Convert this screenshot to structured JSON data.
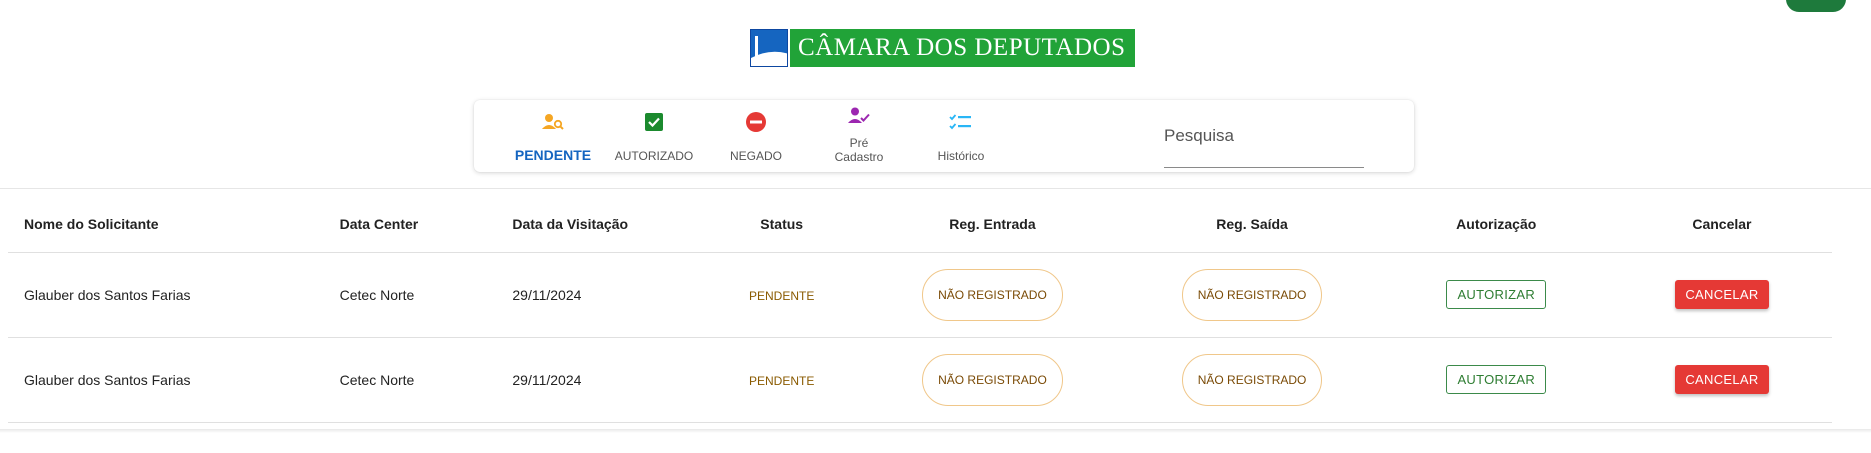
{
  "brand": {
    "name": "CÂMARA DOS DEPUTADOS",
    "green": "#21a338",
    "blue": "#1565c0"
  },
  "tabs": [
    {
      "label": "PENDENTE",
      "icon": "person-search-icon",
      "color": "#f5a623",
      "active": true
    },
    {
      "label": "AUTORIZADO",
      "icon": "checkbox-checked-icon",
      "color": "#1b8a2e",
      "active": false
    },
    {
      "label": "NEGADO",
      "icon": "do-not-enter-icon",
      "color": "#e53935",
      "active": false
    },
    {
      "label_line1": "Pré",
      "label_line2": "Cadastro",
      "icon": "person-check-icon",
      "color": "#9c27b0",
      "active": false
    },
    {
      "label": "Histórico",
      "icon": "checklist-icon",
      "color": "#29b6f6",
      "active": false
    }
  ],
  "search": {
    "placeholder": "Pesquisa",
    "value": ""
  },
  "table": {
    "headers": [
      "Nome do Solicitante",
      "Data Center",
      "Data da Visitação",
      "Status",
      "Reg. Entrada",
      "Reg. Saída",
      "Autorização",
      "Cancelar"
    ],
    "rows": [
      {
        "name": "Glauber dos Santos Farias",
        "datacenter": "Cetec Norte",
        "date": "29/11/2024",
        "status": "PENDENTE",
        "entrada": "NÃO REGISTRADO",
        "saida": "NÃO REGISTRADO",
        "auth_label": "AUTORIZAR",
        "cancel_label": "CANCELAR"
      },
      {
        "name": "Glauber dos Santos Farias",
        "datacenter": "Cetec Norte",
        "date": "29/11/2024",
        "status": "PENDENTE",
        "entrada": "NÃO REGISTRADO",
        "saida": "NÃO REGISTRADO",
        "auth_label": "AUTORIZAR",
        "cancel_label": "CANCELAR"
      }
    ]
  }
}
